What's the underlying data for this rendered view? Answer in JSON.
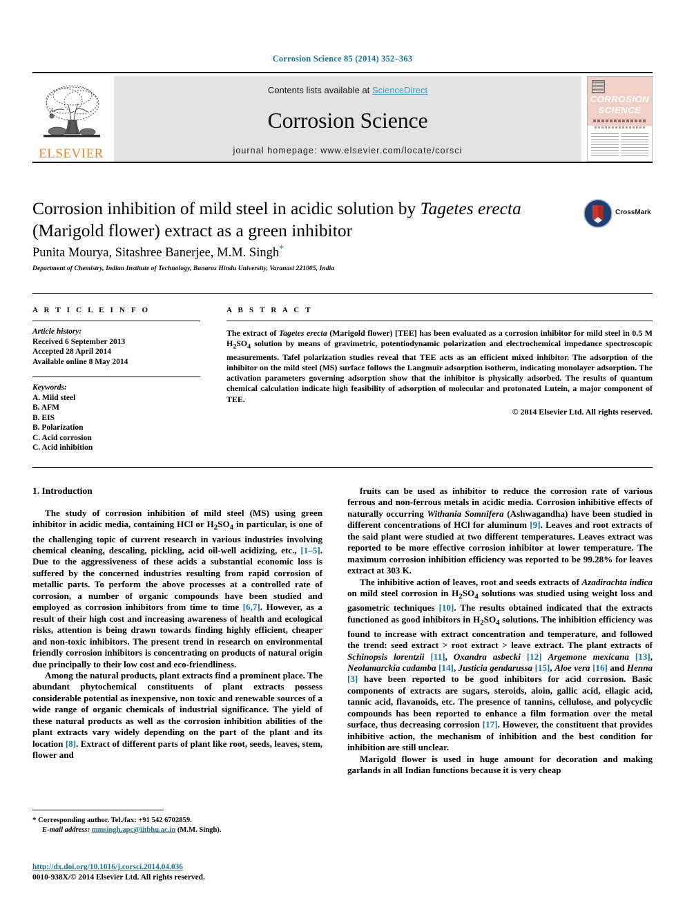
{
  "running_head": "Corrosion Science 85 (2014) 352–363",
  "masthead": {
    "publisher_name": "ELSEVIER",
    "contents_prefix": "Contents lists available at ",
    "sciencedirect": "ScienceDirect",
    "journal_title": "Corrosion Science",
    "homepage": "journal homepage: www.elsevier.com/locate/corsci",
    "cover": {
      "line1": "CORROSION",
      "line2": "SCIENCE"
    }
  },
  "article": {
    "title_part1": "Corrosion inhibition of mild steel in acidic solution by ",
    "title_italic": "Tagetes erecta",
    "title_part2": " (Marigold flower) extract as a green inhibitor",
    "authors": "Punita Mourya, Sitashree Banerjee, M.M. Singh",
    "author_marker": "*",
    "affiliation": "Department of Chemistry, Indian Institute of Technology, Banaras Hindu University, Varanasi 221005, India",
    "crossmark_label": "CrossMark"
  },
  "article_info": {
    "heading": "A R T I C L E   I N F O",
    "history_label": "Article history:",
    "history": [
      "Received 6 September 2013",
      "Accepted 28 April 2014",
      "Available online 8 May 2014"
    ],
    "keywords_label": "Keywords:",
    "keywords": [
      "A. Mild steel",
      "B. AFM",
      "B. EIS",
      "B. Polarization",
      "C. Acid corrosion",
      "C. Acid inhibition"
    ]
  },
  "abstract": {
    "heading": "A B S T R A C T",
    "p1a": "The extract of ",
    "p1_italic": "Tagetes erecta",
    "p1b": " (Marigold flower) [TEE] has been evaluated as a corrosion inhibitor for mild steel in 0.5 M H2SO4 solution by means of gravimetric, potentiodynamic polarization and electrochemical impedance spectroscopic measurements. Tafel polarization studies reveal that TEE acts as an efficient mixed inhibitor. The adsorption of the inhibitor on the mild steel (MS) surface follows the Langmuir adsorption isotherm, indicating monolayer adsorption. The activation parameters governing adsorption show that the inhibitor is physically adsorbed. The results of quantum chemical calculation indicate high feasibility of adsorption of molecular and protonated Lutein, a major component of TEE.",
    "copyright": "© 2014 Elsevier Ltd. All rights reserved."
  },
  "body": {
    "section_title": "1. Introduction",
    "left_p1": "The study of corrosion inhibition of mild steel (MS) using green inhibitor in acidic media, containing HCl or H2SO4 in particular, is one of the challenging topic of current research in various industries involving chemical cleaning, descaling, pickling, acid oil-well acidizing, etc., [1–5]. Due to the aggressiveness of these acids a substantial economic loss is suffered by the concerned industries resulting from rapid corrosion of metallic parts. To perform the above processes at a controlled rate of corrosion, a number of organic compounds have been studied and employed as corrosion inhibitors from time to time [6,7]. However, as a result of their high cost and increasing awareness of health and ecological risks, attention is being drawn towards finding highly efficient, cheaper and non-toxic inhibitors. The present trend in research on environmental friendly corrosion inhibitors is concentrating on products of natural origin due principally to their low cost and eco-friendliness.",
    "left_p2": "Among the natural products, plant extracts find a prominent place. The abundant phytochemical constituents of plant extracts possess considerable potential as inexpensive, non toxic and renewable sources of a wide range of organic chemicals of industrial significance. The yield of these natural products as well as the corrosion inhibition abilities of the plant extracts vary widely depending on the part of the plant and its location [8]. Extract of different parts of plant like root, seeds, leaves, stem, flower and",
    "right_p1": "fruits can be used as inhibitor to reduce the corrosion rate of various ferrous and non-ferrous metals in acidic media. Corrosion inhibitive effects of naturally occurring Withania Somnifera (Ashwagandha) have been studied in different concentrations of HCl for aluminum [9]. Leaves and root extracts of the said plant were studied at two different temperatures. Leaves extract was reported to be more effective corrosion inhibitor at lower temperature. The maximum corrosion inhibition efficiency was reported to be 99.28% for leaves extract at 303 K.",
    "right_p2": "The inhibitive action of leaves, root and seeds extracts of Azadirachta indica on mild steel corrosion in H2SO4 solutions was studied using weight loss and gasometric techniques [10]. The results obtained indicated that the extracts functioned as good inhibitors in H2SO4 solutions. The inhibition efficiency was found to increase with extract concentration and temperature, and followed the trend: seed extract > root extract > leave extract. The plant extracts of Schinopsis lorentzii [11], Oxandra asbecki [12] Argemone mexicana [13], Neolamarckia cadamba [14], Justicia gendarussa [15], Aloe vera [16] and Henna [3] have been reported to be good inhibitors for acid corrosion. Basic components of extracts are sugars, steroids, aloin, gallic acid, ellagic acid, tannic acid, flavanoids, etc. The presence of tannins, cellulose, and polycyclic compounds has been reported to enhance a film formation over the metal surface, thus decreasing corrosion [17]. However, the constituent that provides inhibitive action, the mechanism of inhibition and the best condition for inhibition are still unclear.",
    "right_p3": "Marigold flower is used in huge amount for decoration and making garlands in all Indian functions because it is very cheap"
  },
  "footnote": {
    "star": "*",
    "corresponding": " Corresponding author. Tel./fax: +91 542 6702859.",
    "email_label": "E-mail address:",
    "email": "mmsingh.apc@iitbhu.ac.in",
    "email_owner": "(M.M. Singh).",
    "doi": "http://dx.doi.org/10.1016/j.corsci.2014.04.036",
    "issn_line": "0010-938X/© 2014 Elsevier Ltd. All rights reserved."
  },
  "colors": {
    "link_blue": "#1273a6",
    "sciencedirect_blue": "#3c9cc8",
    "elsevier_orange": "#f08023",
    "cover_salmon": "#f2cfc5",
    "band_gray": "#e3e3e3"
  }
}
